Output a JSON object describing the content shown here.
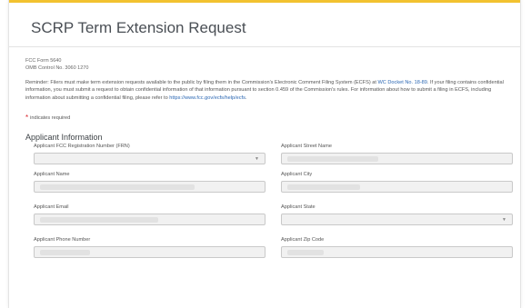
{
  "page": {
    "title": "SCRP Term Extension Request",
    "form_number": "FCC Form 5640",
    "omb_number": "OMB Control No. 3060 1270"
  },
  "reminder": {
    "part1": "Reminder: Filers must make term extension requests available to the public by filing them in the Commission's Electronic Comment Filing System (ECFS) at ",
    "docket_link": "WC Docket No. 18-89",
    "part2": ". If your filing contains confidential information, you must submit a request to obtain confidential information of that information pursuant to section 0.459 of the Commission's rules. For information about how to submit a filing in ECFS, including information about submitting a confidential filing, please refer to ",
    "ecfs_link": "https://www.fcc.gov/ecfs/help/ecfs",
    "part3": "."
  },
  "required_note": {
    "star": "*",
    "text": "indicates required"
  },
  "section": {
    "title": "Applicant Information"
  },
  "fields": {
    "frn": {
      "label": "Applicant FCC Registration Number (FRN)"
    },
    "street": {
      "label": "Applicant Street Name"
    },
    "name": {
      "label": "Applicant Name"
    },
    "city": {
      "label": "Applicant City"
    },
    "email": {
      "label": "Applicant Email"
    },
    "state": {
      "label": "Applicant State"
    },
    "phone": {
      "label": "Applicant Phone Number"
    },
    "zip": {
      "label": "Applicant Zip Code"
    }
  },
  "colors": {
    "accent_bar": "#f2c230",
    "link": "#2b67b3",
    "required": "#d9242b"
  }
}
